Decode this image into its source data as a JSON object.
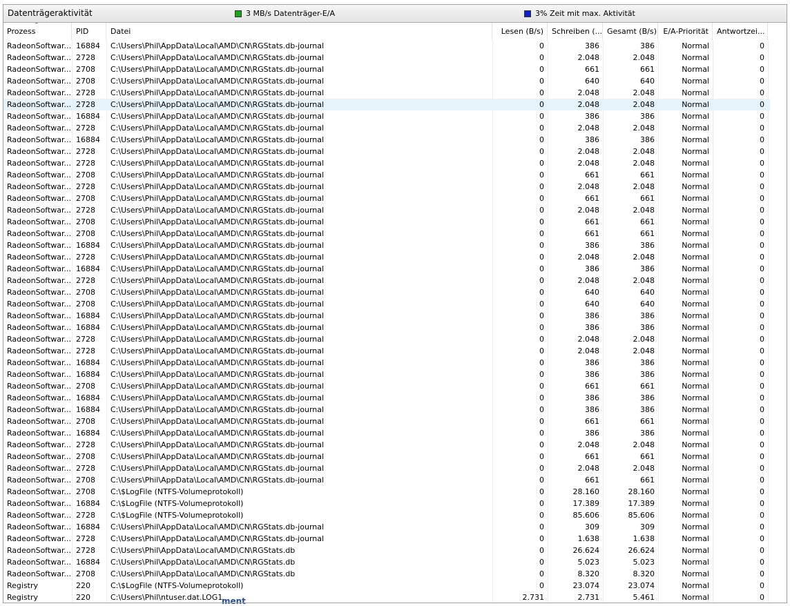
{
  "section": {
    "title": "Datenträgeraktivität",
    "legend": [
      {
        "label": "3 MB/s Datenträger-E/A",
        "color": "#1aa31a"
      },
      {
        "label": "3% Zeit mit max. Aktivität",
        "color": "#1020c0"
      }
    ]
  },
  "columns": {
    "process": "Prozess",
    "pid": "PID",
    "file": "Datei",
    "read": "Lesen (B/s)",
    "write": "Schreiben (...",
    "total": "Gesamt (B/s)",
    "priority": "E/A-Priorität",
    "response": "Antwortzei..."
  },
  "rows": [
    [
      "RadeonSoftwar...",
      "16884",
      "C:\\Users\\Phil\\AppData\\Local\\AMD\\CN\\RGStats.db-journal",
      "0",
      "386",
      "386",
      "Normal",
      "0"
    ],
    [
      "RadeonSoftwar...",
      "2728",
      "C:\\Users\\Phil\\AppData\\Local\\AMD\\CN\\RGStats.db-journal",
      "0",
      "2.048",
      "2.048",
      "Normal",
      "0"
    ],
    [
      "RadeonSoftwar...",
      "2708",
      "C:\\Users\\Phil\\AppData\\Local\\AMD\\CN\\RGStats.db-journal",
      "0",
      "661",
      "661",
      "Normal",
      "0"
    ],
    [
      "RadeonSoftwar...",
      "2708",
      "C:\\Users\\Phil\\AppData\\Local\\AMD\\CN\\RGStats.db-journal",
      "0",
      "640",
      "640",
      "Normal",
      "0"
    ],
    [
      "RadeonSoftwar...",
      "2728",
      "C:\\Users\\Phil\\AppData\\Local\\AMD\\CN\\RGStats.db-journal",
      "0",
      "2.048",
      "2.048",
      "Normal",
      "0"
    ],
    [
      "RadeonSoftwar...",
      "2728",
      "C:\\Users\\Phil\\AppData\\Local\\AMD\\CN\\RGStats.db-journal",
      "0",
      "2.048",
      "2.048",
      "Normal",
      "0"
    ],
    [
      "RadeonSoftwar...",
      "16884",
      "C:\\Users\\Phil\\AppData\\Local\\AMD\\CN\\RGStats.db-journal",
      "0",
      "386",
      "386",
      "Normal",
      "0"
    ],
    [
      "RadeonSoftwar...",
      "2728",
      "C:\\Users\\Phil\\AppData\\Local\\AMD\\CN\\RGStats.db-journal",
      "0",
      "2.048",
      "2.048",
      "Normal",
      "0"
    ],
    [
      "RadeonSoftwar...",
      "16884",
      "C:\\Users\\Phil\\AppData\\Local\\AMD\\CN\\RGStats.db-journal",
      "0",
      "386",
      "386",
      "Normal",
      "0"
    ],
    [
      "RadeonSoftwar...",
      "2728",
      "C:\\Users\\Phil\\AppData\\Local\\AMD\\CN\\RGStats.db-journal",
      "0",
      "2.048",
      "2.048",
      "Normal",
      "0"
    ],
    [
      "RadeonSoftwar...",
      "2728",
      "C:\\Users\\Phil\\AppData\\Local\\AMD\\CN\\RGStats.db-journal",
      "0",
      "2.048",
      "2.048",
      "Normal",
      "0"
    ],
    [
      "RadeonSoftwar...",
      "2708",
      "C:\\Users\\Phil\\AppData\\Local\\AMD\\CN\\RGStats.db-journal",
      "0",
      "661",
      "661",
      "Normal",
      "0"
    ],
    [
      "RadeonSoftwar...",
      "2728",
      "C:\\Users\\Phil\\AppData\\Local\\AMD\\CN\\RGStats.db-journal",
      "0",
      "2.048",
      "2.048",
      "Normal",
      "0"
    ],
    [
      "RadeonSoftwar...",
      "2708",
      "C:\\Users\\Phil\\AppData\\Local\\AMD\\CN\\RGStats.db-journal",
      "0",
      "661",
      "661",
      "Normal",
      "0"
    ],
    [
      "RadeonSoftwar...",
      "2728",
      "C:\\Users\\Phil\\AppData\\Local\\AMD\\CN\\RGStats.db-journal",
      "0",
      "2.048",
      "2.048",
      "Normal",
      "0"
    ],
    [
      "RadeonSoftwar...",
      "2708",
      "C:\\Users\\Phil\\AppData\\Local\\AMD\\CN\\RGStats.db-journal",
      "0",
      "661",
      "661",
      "Normal",
      "0"
    ],
    [
      "RadeonSoftwar...",
      "2708",
      "C:\\Users\\Phil\\AppData\\Local\\AMD\\CN\\RGStats.db-journal",
      "0",
      "661",
      "661",
      "Normal",
      "0"
    ],
    [
      "RadeonSoftwar...",
      "16884",
      "C:\\Users\\Phil\\AppData\\Local\\AMD\\CN\\RGStats.db-journal",
      "0",
      "386",
      "386",
      "Normal",
      "0"
    ],
    [
      "RadeonSoftwar...",
      "2728",
      "C:\\Users\\Phil\\AppData\\Local\\AMD\\CN\\RGStats.db-journal",
      "0",
      "2.048",
      "2.048",
      "Normal",
      "0"
    ],
    [
      "RadeonSoftwar...",
      "16884",
      "C:\\Users\\Phil\\AppData\\Local\\AMD\\CN\\RGStats.db-journal",
      "0",
      "386",
      "386",
      "Normal",
      "0"
    ],
    [
      "RadeonSoftwar...",
      "2728",
      "C:\\Users\\Phil\\AppData\\Local\\AMD\\CN\\RGStats.db-journal",
      "0",
      "2.048",
      "2.048",
      "Normal",
      "0"
    ],
    [
      "RadeonSoftwar...",
      "2708",
      "C:\\Users\\Phil\\AppData\\Local\\AMD\\CN\\RGStats.db-journal",
      "0",
      "640",
      "640",
      "Normal",
      "0"
    ],
    [
      "RadeonSoftwar...",
      "2708",
      "C:\\Users\\Phil\\AppData\\Local\\AMD\\CN\\RGStats.db-journal",
      "0",
      "640",
      "640",
      "Normal",
      "0"
    ],
    [
      "RadeonSoftwar...",
      "16884",
      "C:\\Users\\Phil\\AppData\\Local\\AMD\\CN\\RGStats.db-journal",
      "0",
      "386",
      "386",
      "Normal",
      "0"
    ],
    [
      "RadeonSoftwar...",
      "16884",
      "C:\\Users\\Phil\\AppData\\Local\\AMD\\CN\\RGStats.db-journal",
      "0",
      "386",
      "386",
      "Normal",
      "0"
    ],
    [
      "RadeonSoftwar...",
      "2728",
      "C:\\Users\\Phil\\AppData\\Local\\AMD\\CN\\RGStats.db-journal",
      "0",
      "2.048",
      "2.048",
      "Normal",
      "0"
    ],
    [
      "RadeonSoftwar...",
      "2728",
      "C:\\Users\\Phil\\AppData\\Local\\AMD\\CN\\RGStats.db-journal",
      "0",
      "2.048",
      "2.048",
      "Normal",
      "0"
    ],
    [
      "RadeonSoftwar...",
      "16884",
      "C:\\Users\\Phil\\AppData\\Local\\AMD\\CN\\RGStats.db-journal",
      "0",
      "386",
      "386",
      "Normal",
      "0"
    ],
    [
      "RadeonSoftwar...",
      "16884",
      "C:\\Users\\Phil\\AppData\\Local\\AMD\\CN\\RGStats.db-journal",
      "0",
      "386",
      "386",
      "Normal",
      "0"
    ],
    [
      "RadeonSoftwar...",
      "2708",
      "C:\\Users\\Phil\\AppData\\Local\\AMD\\CN\\RGStats.db-journal",
      "0",
      "661",
      "661",
      "Normal",
      "0"
    ],
    [
      "RadeonSoftwar...",
      "16884",
      "C:\\Users\\Phil\\AppData\\Local\\AMD\\CN\\RGStats.db-journal",
      "0",
      "386",
      "386",
      "Normal",
      "0"
    ],
    [
      "RadeonSoftwar...",
      "16884",
      "C:\\Users\\Phil\\AppData\\Local\\AMD\\CN\\RGStats.db-journal",
      "0",
      "386",
      "386",
      "Normal",
      "0"
    ],
    [
      "RadeonSoftwar...",
      "2708",
      "C:\\Users\\Phil\\AppData\\Local\\AMD\\CN\\RGStats.db-journal",
      "0",
      "661",
      "661",
      "Normal",
      "0"
    ],
    [
      "RadeonSoftwar...",
      "16884",
      "C:\\Users\\Phil\\AppData\\Local\\AMD\\CN\\RGStats.db-journal",
      "0",
      "386",
      "386",
      "Normal",
      "0"
    ],
    [
      "RadeonSoftwar...",
      "2728",
      "C:\\Users\\Phil\\AppData\\Local\\AMD\\CN\\RGStats.db-journal",
      "0",
      "2.048",
      "2.048",
      "Normal",
      "0"
    ],
    [
      "RadeonSoftwar...",
      "2708",
      "C:\\Users\\Phil\\AppData\\Local\\AMD\\CN\\RGStats.db-journal",
      "0",
      "661",
      "661",
      "Normal",
      "0"
    ],
    [
      "RadeonSoftwar...",
      "2728",
      "C:\\Users\\Phil\\AppData\\Local\\AMD\\CN\\RGStats.db-journal",
      "0",
      "2.048",
      "2.048",
      "Normal",
      "0"
    ],
    [
      "RadeonSoftwar...",
      "2708",
      "C:\\Users\\Phil\\AppData\\Local\\AMD\\CN\\RGStats.db-journal",
      "0",
      "661",
      "661",
      "Normal",
      "0"
    ],
    [
      "RadeonSoftwar...",
      "2708",
      "C:\\$LogFile (NTFS-Volumeprotokoll)",
      "0",
      "28.160",
      "28.160",
      "Normal",
      "0"
    ],
    [
      "RadeonSoftwar...",
      "16884",
      "C:\\$LogFile (NTFS-Volumeprotokoll)",
      "0",
      "17.389",
      "17.389",
      "Normal",
      "0"
    ],
    [
      "RadeonSoftwar...",
      "2728",
      "C:\\$LogFile (NTFS-Volumeprotokoll)",
      "0",
      "85.606",
      "85.606",
      "Normal",
      "0"
    ],
    [
      "RadeonSoftwar...",
      "16884",
      "C:\\Users\\Phil\\AppData\\Local\\AMD\\CN\\RGStats.db-journal",
      "0",
      "309",
      "309",
      "Normal",
      "0"
    ],
    [
      "RadeonSoftwar...",
      "2728",
      "C:\\Users\\Phil\\AppData\\Local\\AMD\\CN\\RGStats.db-journal",
      "0",
      "1.638",
      "1.638",
      "Normal",
      "0"
    ],
    [
      "RadeonSoftwar...",
      "2728",
      "C:\\Users\\Phil\\AppData\\Local\\AMD\\CN\\RGStats.db",
      "0",
      "26.624",
      "26.624",
      "Normal",
      "0"
    ],
    [
      "RadeonSoftwar...",
      "16884",
      "C:\\Users\\Phil\\AppData\\Local\\AMD\\CN\\RGStats.db",
      "0",
      "5.023",
      "5.023",
      "Normal",
      "0"
    ],
    [
      "RadeonSoftwar...",
      "2708",
      "C:\\Users\\Phil\\AppData\\Local\\AMD\\CN\\RGStats.db",
      "0",
      "8.320",
      "8.320",
      "Normal",
      "0"
    ],
    [
      "Registry",
      "220",
      "C:\\$LogFile (NTFS-Volumeprotokoll)",
      "0",
      "23.074",
      "23.074",
      "Normal",
      "0"
    ],
    [
      "Registry",
      "220",
      "C:\\Users\\Phil\\ntuser.dat.LOG1",
      "2.731",
      "2.731",
      "5.461",
      "Normal",
      "0"
    ]
  ],
  "selected_row": 5,
  "overlay_text": "ment"
}
